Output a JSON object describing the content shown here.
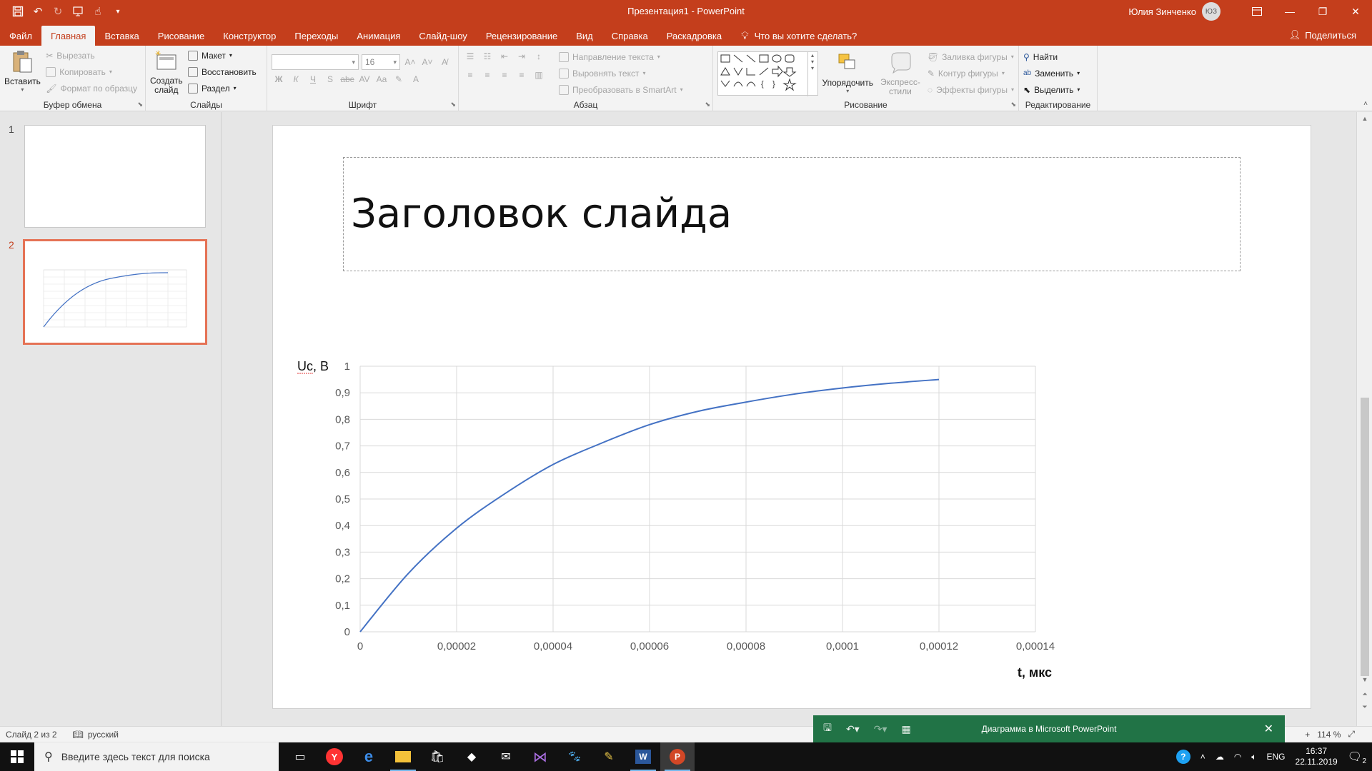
{
  "window": {
    "title": "Презентация1  -  PowerPoint",
    "user_name": "Юлия Зинченко",
    "user_initials": "ЮЗ"
  },
  "qat": {
    "icons": [
      "save-icon",
      "undo-icon",
      "redo-icon",
      "start-from-beginning-icon",
      "touch-mode-icon",
      "customize-qat-icon"
    ]
  },
  "tabs": [
    {
      "label": "Файл",
      "active": false
    },
    {
      "label": "Главная",
      "active": true
    },
    {
      "label": "Вставка",
      "active": false
    },
    {
      "label": "Рисование",
      "active": false
    },
    {
      "label": "Конструктор",
      "active": false
    },
    {
      "label": "Переходы",
      "active": false
    },
    {
      "label": "Анимация",
      "active": false
    },
    {
      "label": "Слайд-шоу",
      "active": false
    },
    {
      "label": "Рецензирование",
      "active": false
    },
    {
      "label": "Вид",
      "active": false
    },
    {
      "label": "Справка",
      "active": false
    },
    {
      "label": "Раскадровка",
      "active": false
    }
  ],
  "tellme": "Что вы хотите сделать?",
  "share": "Поделиться",
  "ribbon": {
    "clipboard": {
      "label": "Буфер обмена",
      "paste": "Вставить",
      "cut": "Вырезать",
      "copy": "Копировать",
      "format_painter": "Формат по образцу"
    },
    "slides": {
      "label": "Слайды",
      "new_slide_1": "Создать",
      "new_slide_2": "слайд",
      "layout": "Макет",
      "reset": "Восстановить",
      "section": "Раздел"
    },
    "font": {
      "label": "Шрифт",
      "size": "16"
    },
    "paragraph": {
      "label": "Абзац",
      "text_direction": "Направление текста",
      "align_text": "Выровнять текст",
      "smartart": "Преобразовать в SmartArt"
    },
    "drawing": {
      "label": "Рисование",
      "arrange": "Упорядочить",
      "quick_styles_1": "Экспресс-",
      "quick_styles_2": "стили",
      "shape_fill": "Заливка фигуры",
      "shape_outline": "Контур фигуры",
      "shape_effects": "Эффекты фигуры"
    },
    "editing": {
      "label": "Редактирование",
      "find": "Найти",
      "replace": "Заменить",
      "select": "Выделить"
    }
  },
  "thumbnails": [
    {
      "number": "1",
      "active": false
    },
    {
      "number": "2",
      "active": true
    }
  ],
  "slide": {
    "title": "Заголовок слайда"
  },
  "chart_data": {
    "type": "line",
    "title": "",
    "xlabel": "t, мкс",
    "ylabel": "Uc, В",
    "xlim": [
      0,
      0.00014
    ],
    "ylim": [
      0,
      1
    ],
    "x_ticks": [
      "0",
      "0,00002",
      "0,00004",
      "0,00006",
      "0,00008",
      "0,0001",
      "0,00012",
      "0,00014"
    ],
    "y_ticks": [
      "0",
      "0,1",
      "0,2",
      "0,3",
      "0,4",
      "0,5",
      "0,6",
      "0,7",
      "0,8",
      "0,9",
      "1"
    ],
    "grid": true,
    "line_color": "#4472c4",
    "series": [
      {
        "x": [
          0,
          1e-05,
          2e-05,
          3e-05,
          4e-05,
          5e-05,
          6e-05,
          7e-05,
          8e-05,
          9e-05,
          0.0001,
          0.00011,
          0.00012
        ],
        "values": [
          0,
          0.22,
          0.39,
          0.52,
          0.63,
          0.71,
          0.78,
          0.83,
          0.865,
          0.895,
          0.918,
          0.936,
          0.95
        ]
      }
    ]
  },
  "statusbar": {
    "slide_counter": "Слайд 2 из 2",
    "language": "русский",
    "zoom": "114 %"
  },
  "notification": {
    "text": "Диаграмма в Microsoft PowerPoint"
  },
  "taskbar": {
    "search_placeholder": "Введите здесь текст для поиска",
    "apps": [
      "task-view-icon",
      "yandex-browser-icon",
      "edge-icon",
      "file-explorer-icon",
      "store-icon",
      "dropbox-icon",
      "mail-icon",
      "visual-studio-icon",
      "paw-app-icon",
      "notepad-icon",
      "word-icon",
      "powerpoint-icon"
    ],
    "lang": "ENG",
    "time": "16:37",
    "date": "22.11.2019",
    "notifications_count": "2"
  },
  "colors": {
    "accent": "#c43e1c",
    "excel_green": "#217346",
    "chart_line": "#4472c4"
  }
}
